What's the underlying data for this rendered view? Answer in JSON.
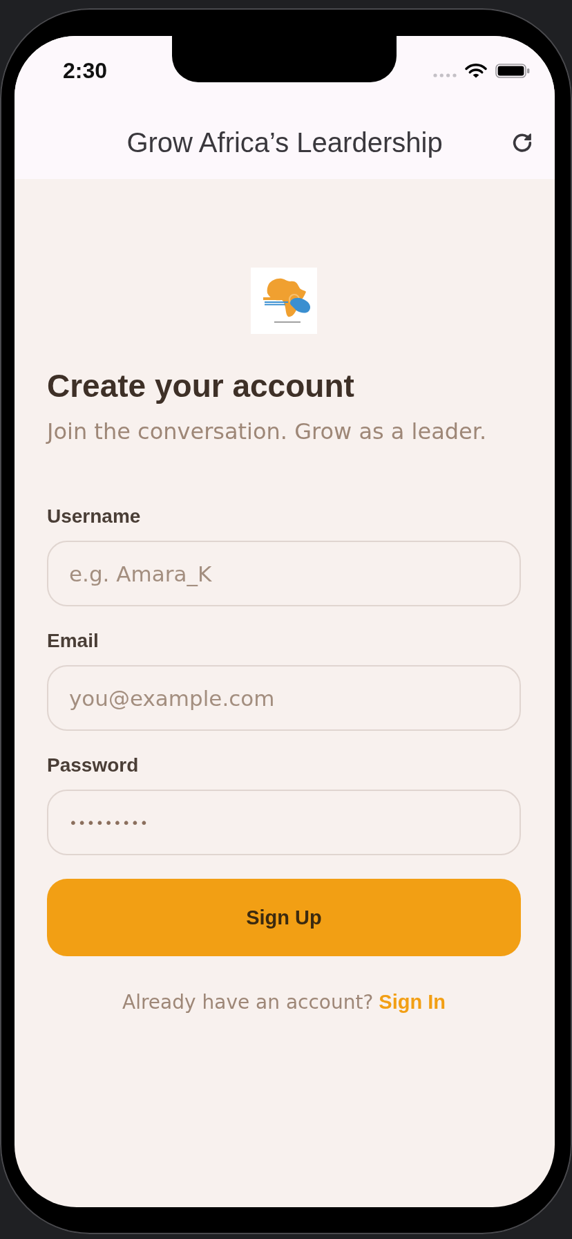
{
  "status_bar": {
    "time": "2:30"
  },
  "app_bar": {
    "title": "Grow Africa’s Leardership"
  },
  "form": {
    "title": "Create your account",
    "subtitle": "Join the conversation. Grow as a leader.",
    "fields": [
      {
        "label": "Username",
        "placeholder": "e.g. Amara_K"
      },
      {
        "label": "Email",
        "placeholder": "you@example.com"
      },
      {
        "label": "Password",
        "value": "•••••••••"
      }
    ],
    "submit_button": "Sign Up",
    "footer": {
      "prompt": "Already have an account?",
      "link": "Sign In"
    }
  }
}
